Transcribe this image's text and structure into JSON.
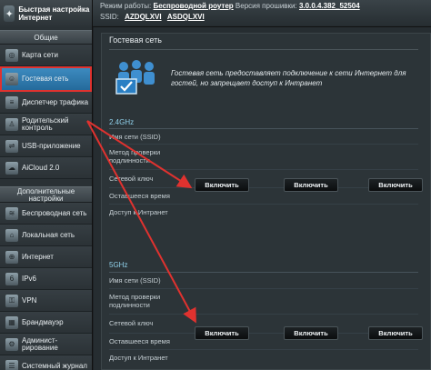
{
  "header": {
    "quick_setup": "Быстрая настройка Интернет",
    "mode_prefix": "Режим работы:",
    "mode_value": "Беспроводной роутер",
    "version_prefix": "Версия прошивки:",
    "version_value": "3.0.0.4.382_52504",
    "ssid_prefix": "SSID:",
    "ssid_1": "AZDQLXVI",
    "ssid_2": "ASDQLXVI"
  },
  "sidebar": {
    "general_title": "Общие",
    "items": [
      {
        "label": "Карта сети",
        "icon": "network-map-icon"
      },
      {
        "label": "Гостевая сеть",
        "icon": "guest-network-icon",
        "active": true
      },
      {
        "label": "Диспетчер трафика",
        "icon": "traffic-manager-icon"
      },
      {
        "label": "Родительский контроль",
        "icon": "parental-control-icon"
      },
      {
        "label": "USB-приложение",
        "icon": "usb-icon"
      },
      {
        "label": "AiCloud 2.0",
        "icon": "cloud-icon"
      }
    ],
    "advanced_title": "Дополнительные настройки",
    "advanced_items": [
      {
        "label": "Беспроводная сеть",
        "icon": "wireless-icon"
      },
      {
        "label": "Локальная сеть",
        "icon": "lan-icon"
      },
      {
        "label": "Интернет",
        "icon": "wan-icon"
      },
      {
        "label": "IPv6",
        "icon": "ipv6-icon"
      },
      {
        "label": "VPN",
        "icon": "vpn-icon"
      },
      {
        "label": "Брандмауэр",
        "icon": "firewall-icon"
      },
      {
        "label": "Админист-рирование",
        "icon": "admin-icon"
      },
      {
        "label": "Системный журнал",
        "icon": "syslog-icon"
      }
    ]
  },
  "main": {
    "title": "Гостевая сеть",
    "intro": "Гостевая сеть предоставляет подключение к сети Интернет для гостей, но запрещает доступ к Интранет",
    "band_24": "2.4GHz",
    "band_5": "5GHz",
    "rows": {
      "ssid": "Имя сети (SSID)",
      "auth": "Метод проверки подлинности",
      "key": "Сетевой ключ",
      "time": "Оставшееся время",
      "intranet": "Доступ к Интранет"
    },
    "enable_label": "Включить"
  },
  "colors": {
    "active_nav": "#2f7fb5",
    "highlight": "#e0322f",
    "band_text": "#8fd0ea"
  }
}
